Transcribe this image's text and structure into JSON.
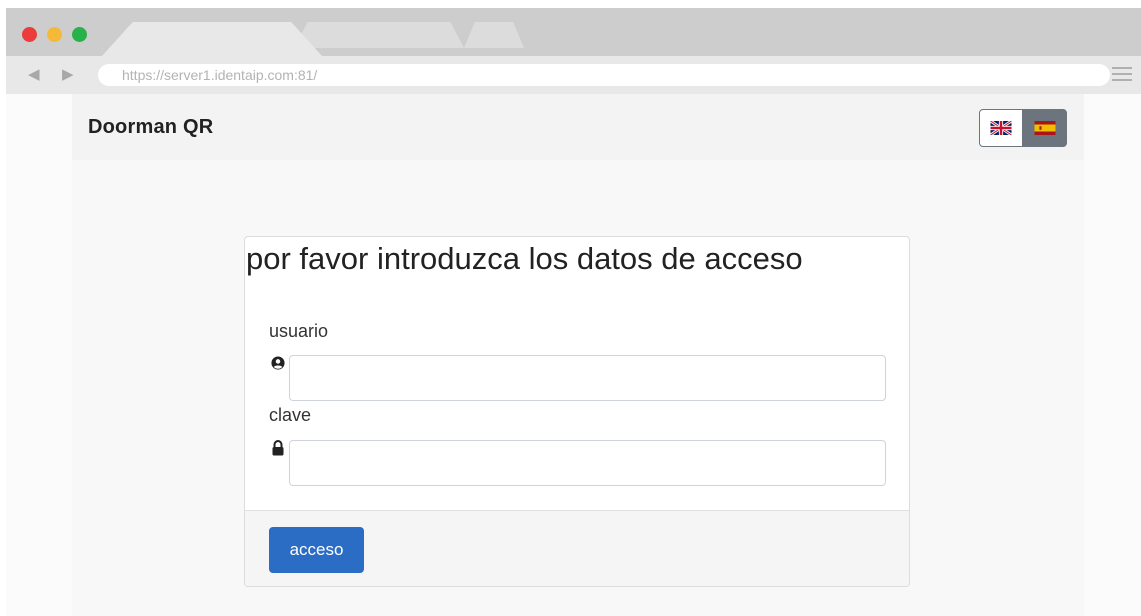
{
  "browser": {
    "url": "https://server1.identaip.com:81/",
    "back_icon": "back-arrow-icon",
    "forward_icon": "forward-arrow-icon",
    "menu_icon": "hamburger-menu-icon"
  },
  "navbar": {
    "brand": "Doorman QR",
    "languages": [
      {
        "code": "en",
        "icon": "uk-flag-icon",
        "active": false
      },
      {
        "code": "es",
        "icon": "spain-flag-icon",
        "active": true
      }
    ]
  },
  "login": {
    "title": "por favor introduzca los datos de acceso",
    "username_label": "usuario",
    "username_value": "",
    "username_icon": "user-circle-icon",
    "password_label": "clave",
    "password_value": "",
    "password_icon": "lock-icon",
    "submit_label": "acceso"
  },
  "colors": {
    "primary_button": "#2b6cc4",
    "active_lang_button": "#6c757d"
  }
}
